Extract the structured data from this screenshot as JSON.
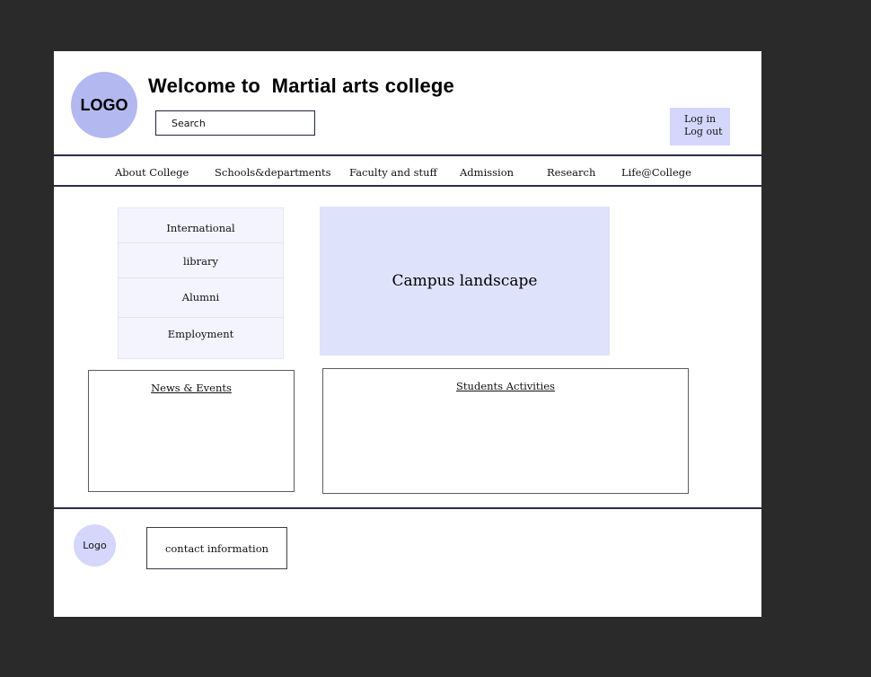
{
  "header": {
    "logo_text": "LOGO",
    "title": "Welcome to  Martial arts college",
    "search_placeholder": "Search",
    "login_label": "Log in",
    "logout_label": "Log out"
  },
  "nav": {
    "items": [
      {
        "label": "About College"
      },
      {
        "label": "Schools&departments"
      },
      {
        "label": "Faculty and stuff"
      },
      {
        "label": "Admission"
      },
      {
        "label": "Research"
      },
      {
        "label": "Life@College"
      }
    ]
  },
  "side_menu": {
    "items": [
      {
        "label": "International"
      },
      {
        "label": "library"
      },
      {
        "label": "Alumni"
      },
      {
        "label": "Employment"
      }
    ]
  },
  "hero": {
    "label": "Campus landscape"
  },
  "panels": {
    "news_title": "News & Events",
    "activities_title": "Students Activities"
  },
  "footer": {
    "logo_text": "Logo",
    "contact_label": "contact information"
  },
  "colors": {
    "logo_fill": "#b3b8f0",
    "auth_fill": "#d4d7fb",
    "hero_fill": "#dfe2fb",
    "side_menu_fill": "#f3f4fd",
    "rule_color": "#2a2e4c",
    "backdrop": "#2a2a2a"
  }
}
